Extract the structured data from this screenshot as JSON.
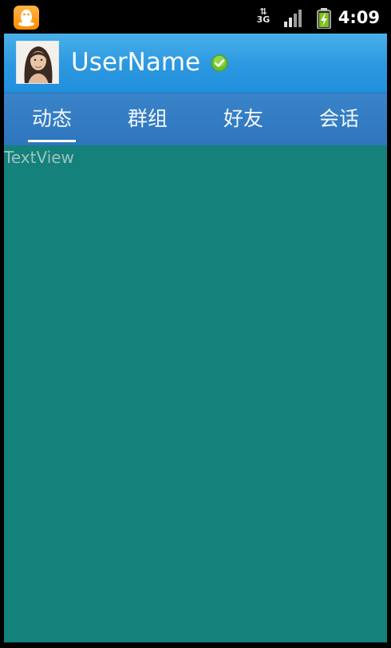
{
  "status_bar": {
    "notification_icon": "qq-penguin-icon",
    "network_label": "3G",
    "signal_icon": "signal-bars-icon",
    "battery_icon": "battery-charging-icon",
    "time": "4:09"
  },
  "header": {
    "avatar_icon": "user-avatar-photo",
    "username": "UserName",
    "status_icon": "online-check-icon"
  },
  "tabs": [
    {
      "label": "动态",
      "selected": true
    },
    {
      "label": "群组",
      "selected": false
    },
    {
      "label": "好友",
      "selected": false
    },
    {
      "label": "会话",
      "selected": false
    }
  ],
  "content": {
    "text": "TextView"
  },
  "colors": {
    "title_bar": "#2b97df",
    "tab_bar": "#3380c4",
    "content_background": "#14817b",
    "tab_indicator": "#ffffff"
  }
}
